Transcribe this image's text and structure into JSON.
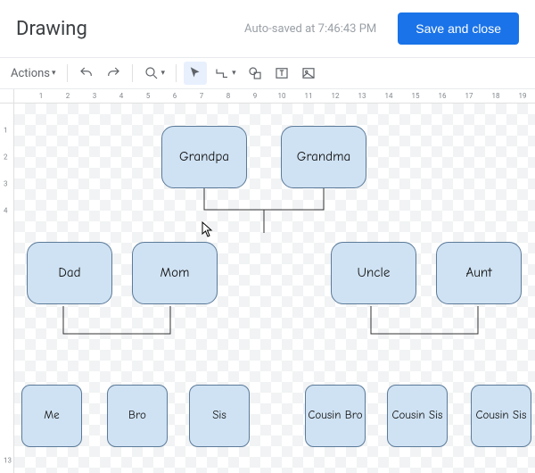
{
  "header": {
    "title": "Drawing",
    "autosave": "Auto-saved at 7:46:43 PM",
    "save_label": "Save and close"
  },
  "toolbar": {
    "actions_label": "Actions"
  },
  "ruler": {
    "h": [
      "1",
      "2",
      "3",
      "4",
      "5",
      "6",
      "7",
      "8",
      "9",
      "10",
      "11",
      "12",
      "13",
      "14",
      "15",
      "16",
      "17",
      "18",
      "19"
    ],
    "v": [
      "1",
      "2",
      "3",
      "4",
      "13"
    ]
  },
  "nodes": {
    "grandpa": "Grandpa",
    "grandma": "Grandma",
    "dad": "Dad",
    "mom": "Mom",
    "uncle": "Uncle",
    "aunt": "Aunt",
    "me": "Me",
    "bro": "Bro",
    "sis": "Sis",
    "cousin_bro": "Cousin Bro",
    "cousin_sis1": "Cousin Sis",
    "cousin_sis2": "Cousin Sis"
  }
}
